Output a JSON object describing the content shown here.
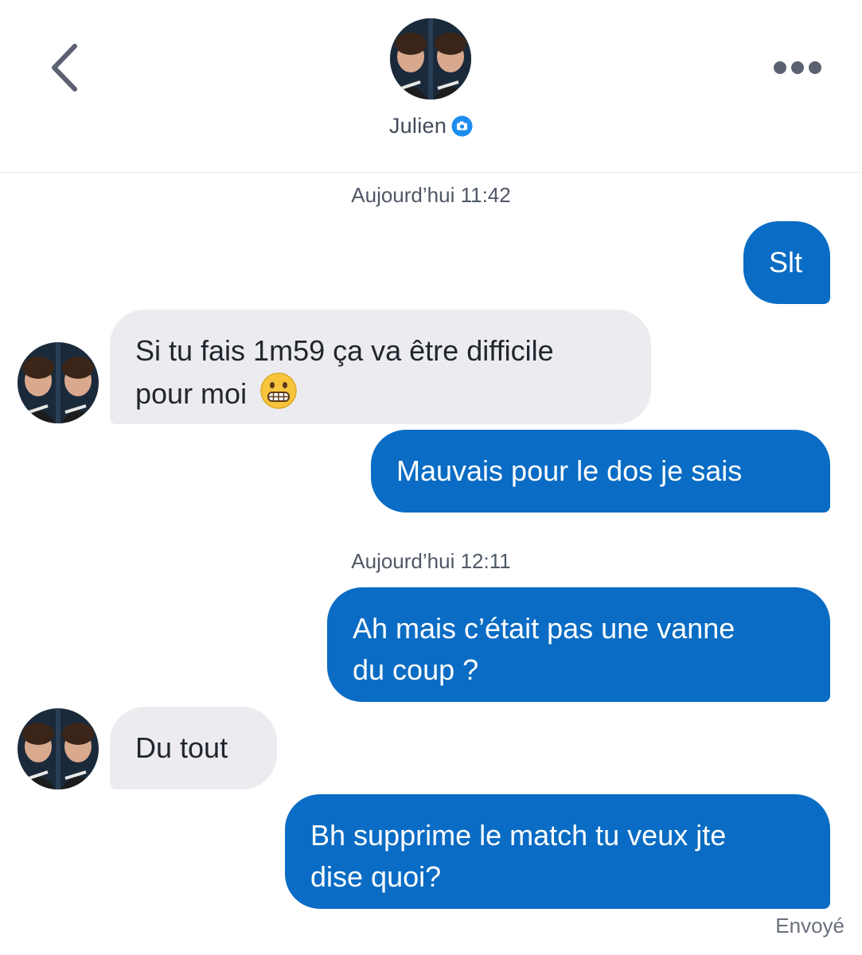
{
  "header": {
    "contact_name": "Julien",
    "back_icon": "chevron-left-icon",
    "more_icon": "more-horizontal-icon",
    "verified_icon": "camera-badge-icon",
    "accent_color": "#0a6cc4"
  },
  "conversation": {
    "timestamps": [
      "Aujourd’hui 11:42",
      "Aujourd’hui 12:11"
    ],
    "messages": [
      {
        "from": "me",
        "line1": "Slt",
        "line2": ""
      },
      {
        "from": "them",
        "line1": "Si tu fais 1m59 ça va être difficile",
        "line2": "pour moi",
        "emoji": "grimacing-face-emoji"
      },
      {
        "from": "me",
        "line1": "Mauvais pour le dos je sais",
        "line2": ""
      },
      {
        "from": "me",
        "line1": "Ah mais c’était pas une vanne",
        "line2": "du coup ?"
      },
      {
        "from": "them",
        "line1": "Du tout",
        "line2": ""
      },
      {
        "from": "me",
        "line1": "Bh supprime le match tu veux jte",
        "line2": "dise quoi?"
      }
    ],
    "status": "Envoyé"
  }
}
